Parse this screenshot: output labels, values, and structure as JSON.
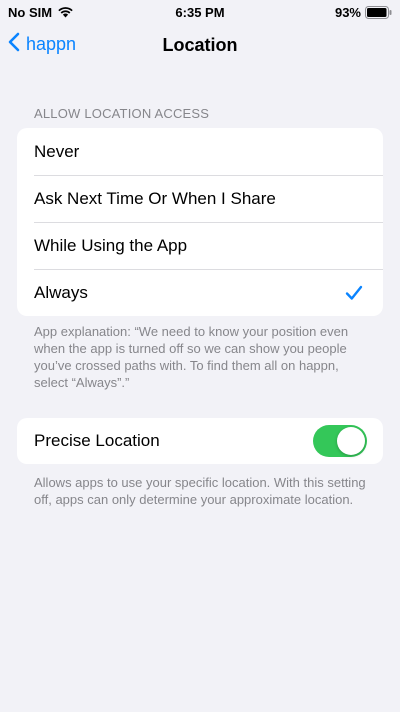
{
  "status_bar": {
    "carrier": "No SIM",
    "time": "6:35 PM",
    "battery": "93%"
  },
  "nav": {
    "back_label": "happn",
    "title": "Location"
  },
  "location_access": {
    "header": "ALLOW LOCATION ACCESS",
    "options": [
      {
        "label": "Never",
        "selected": false
      },
      {
        "label": "Ask Next Time Or When I Share",
        "selected": false
      },
      {
        "label": "While Using the App",
        "selected": false
      },
      {
        "label": "Always",
        "selected": true
      }
    ],
    "explanation": "App explanation: “We need to know your position even when the app is turned off so we can show you people you’ve crossed paths with. To find them all on happn, select “Always”.”"
  },
  "precise_location": {
    "label": "Precise Location",
    "enabled": true,
    "description": "Allows apps to use your specific location. With this setting off, apps can only determine your approximate location."
  },
  "colors": {
    "accent": "#0a84ff",
    "toggle_on": "#34c759",
    "background": "#f2f2f7",
    "secondary_text": "#86868b"
  },
  "icons": {
    "wifi": "wifi-icon",
    "battery": "battery-icon",
    "back": "chevron-left-icon",
    "check": "checkmark-icon"
  }
}
